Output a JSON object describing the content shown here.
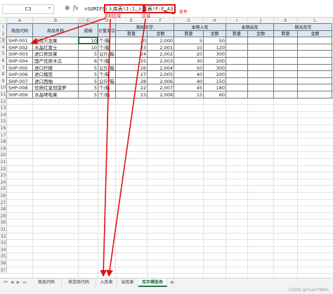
{
  "formula_bar": {
    "name_box": "C3",
    "fx_label": "fx",
    "formula": "=SUMIFS(入库表!J:J,入库表!F:F,A3)"
  },
  "annotations": {
    "sum_range": "求和区域",
    "range": "区域",
    "condition": "条件"
  },
  "columns": [
    "A",
    "B",
    "C",
    "D",
    "E",
    "F",
    "G",
    "H",
    "I",
    "J",
    "K",
    "L"
  ],
  "selected_column": "C",
  "selected_row": "3",
  "rows": [
    "1",
    "2",
    "3",
    "4",
    "5",
    "6",
    "7",
    "8",
    "9",
    "10",
    "11",
    "12",
    "13",
    "14",
    "15",
    "16",
    "17",
    "18",
    "19",
    "20",
    "21",
    "22",
    "23",
    "24",
    "25",
    "26",
    "27",
    "28",
    "29",
    "30",
    "31",
    "32",
    "33",
    "34",
    "35",
    "36",
    "37"
  ],
  "table_header": {
    "product_code": "商品代码",
    "product_name": "商品名称",
    "spec": "规格",
    "unit": "计量单位",
    "opening_stock": "期初库存",
    "period_in": "本期入库",
    "period_out": "本期出库",
    "closing_stock": "期末库存",
    "qty": "数量",
    "amount": "金额"
  },
  "table_rows": [
    {
      "code": "SHP-001",
      "name": "越南火龙果",
      "spec": "10",
      "unit": "个/箱",
      "open_qty": "20",
      "open_amt": "2,000",
      "in_qty": "5",
      "in_amt": "50"
    },
    {
      "code": "SHP-002",
      "name": "水晶红富士",
      "spec": "10",
      "unit": "个/箱",
      "open_qty": "23",
      "open_amt": "2,001",
      "in_qty": "10",
      "in_amt": "120"
    },
    {
      "code": "SHP-003",
      "name": "进口奇异果",
      "spec": "5",
      "unit": "公斤/箱",
      "open_qty": "24",
      "open_amt": "2,002",
      "in_qty": "20",
      "in_amt": "300"
    },
    {
      "code": "SHP-004",
      "name": "国产优质木瓜",
      "spec": "6",
      "unit": "个/箱",
      "open_qty": "25",
      "open_amt": "2,003",
      "in_qty": "30",
      "in_amt": "200"
    },
    {
      "code": "SHP-005",
      "name": "进口柠檬",
      "spec": "5",
      "unit": "公斤/箱",
      "open_qty": "26",
      "open_amt": "2,004",
      "in_qty": "50",
      "in_amt": "300"
    },
    {
      "code": "SHP-006",
      "name": "进口榴莲",
      "spec": "5",
      "unit": "个/箱",
      "open_qty": "27",
      "open_amt": "2,005",
      "in_qty": "40",
      "in_amt": "200"
    },
    {
      "code": "SHP-007",
      "name": "进口西柚",
      "spec": "5",
      "unit": "公斤/箱",
      "open_qty": "28",
      "open_amt": "2,006",
      "in_qty": "40",
      "in_amt": "150"
    },
    {
      "code": "SHP-008",
      "name": "优质红皇冠菠萝",
      "spec": "5",
      "unit": "个/箱",
      "open_qty": "22",
      "open_amt": "2,007",
      "in_qty": "45",
      "in_amt": "180"
    },
    {
      "code": "SHP-009",
      "name": "水晶啤啦果",
      "spec": "5",
      "unit": "个/箱",
      "open_qty": "23",
      "open_amt": "2,008",
      "in_qty": "15",
      "in_amt": "60"
    }
  ],
  "sheet_tabs": [
    {
      "label": "商品代码",
      "active": false
    },
    {
      "label": "供货商代码",
      "active": false
    },
    {
      "label": "入库表",
      "active": false
    },
    {
      "label": "出库表",
      "active": false
    },
    {
      "label": "库存模版表",
      "active": true
    }
  ],
  "watermark": "CSDN @YuanYWRS"
}
